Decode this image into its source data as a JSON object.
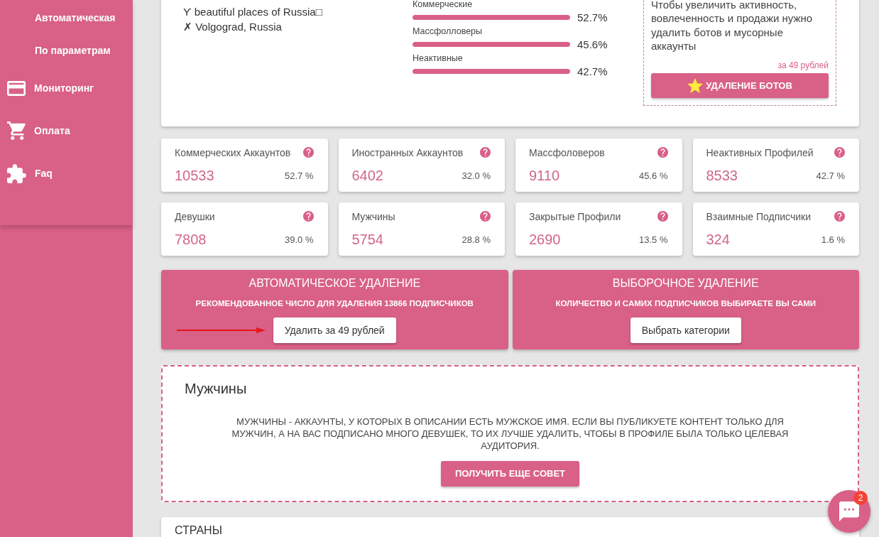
{
  "sidebar": {
    "items": [
      {
        "label": "Автоматическая",
        "kind": "subitem"
      },
      {
        "label": "По параметрам",
        "kind": "subitem"
      },
      {
        "label": "Мониторинг",
        "kind": "item"
      },
      {
        "label": "Оплата",
        "kind": "item"
      },
      {
        "label": "Faq",
        "kind": "item"
      }
    ]
  },
  "profile": {
    "lines": [
      "ϒ beautiful places of Russia□",
      "✗ Volgograd, Russia"
    ]
  },
  "breakdown": [
    {
      "label": "Коммерческие",
      "level": 1,
      "reading": "52.7%"
    },
    {
      "label": "Массфолловеры",
      "level": 1,
      "reading": "45.6%"
    },
    {
      "label": "Неактивные",
      "level": 1,
      "reading": "42.7%"
    }
  ],
  "promo": {
    "text": "Чтобы увеличить активность, вовлеченность и продажи нужно удалить ботов и мусорные аккаунты",
    "price": "за 49 рублей",
    "button": "УДАЛЕНИЕ БОТОВ"
  },
  "stats": [
    {
      "label": "Коммерческих Аккаунтов",
      "value": "10533",
      "percent": "52.7 %"
    },
    {
      "label": "Иностранных Аккаунтов",
      "value": "6402",
      "percent": "32.0 %"
    },
    {
      "label": "Массфоловеров",
      "value": "9110",
      "percent": "45.6 %"
    },
    {
      "label": "Неактивных Профилей",
      "value": "8533",
      "percent": "42.7 %"
    },
    {
      "label": "Девушки",
      "value": "7808",
      "percent": "39.0 %"
    },
    {
      "label": "Мужчины",
      "value": "5754",
      "percent": "28.8 %"
    },
    {
      "label": "Закрытые Профили",
      "value": "2690",
      "percent": "13.5 %"
    },
    {
      "label": "Взаимные Подписчики",
      "value": "324",
      "percent": "1.6 %"
    }
  ],
  "actions": [
    {
      "title": "АВТОМАТИЧЕСКОЕ УДАЛЕНИЕ",
      "subtitle": "РЕКОМЕНДОВАННОЕ ЧИСЛО ДЛЯ УДАЛЕНИЯ 13866 ПОДПИСЧИКОВ",
      "button": "Удалить за 49 рублей",
      "pointer_arrow": true
    },
    {
      "title": "ВЫБОРОЧНОЕ УДАЛЕНИЕ",
      "subtitle": "КОЛИЧЕСТВО И САМИХ ПОДПИСЧИКОВ ВЫБИРАЕТЕ ВЫ САМИ",
      "button": "Выбрать категории",
      "pointer_arrow": false
    }
  ],
  "tip": {
    "title": "Мужчины",
    "text": "МУЖЧИНЫ - АККАУНТЫ, У КОТОРЫХ В ОПИСАНИИ ЕСТЬ МУЖСКОЕ ИМЯ. ЕСЛИ ВЫ ПУБЛИКУЕТЕ КОНТЕНТ ТОЛЬКО ДЛЯ МУЖЧИН, А НА ВАС ПОДПИСАНО МНОГО ДЕВУШЕК, ТО ИХ ЛУЧШЕ УДАЛИТЬ, ЧТОБЫ В ПРОФИЛЕ БЫЛА ТОЛЬКО ЦЕЛЕВАЯ АУДИТОРИЯ.",
    "button": "ПОЛУЧИТЬ ЕЩЕ СОВЕТ"
  },
  "countries": {
    "title": "СТРАНЫ"
  },
  "chat": {
    "badge": "2"
  }
}
